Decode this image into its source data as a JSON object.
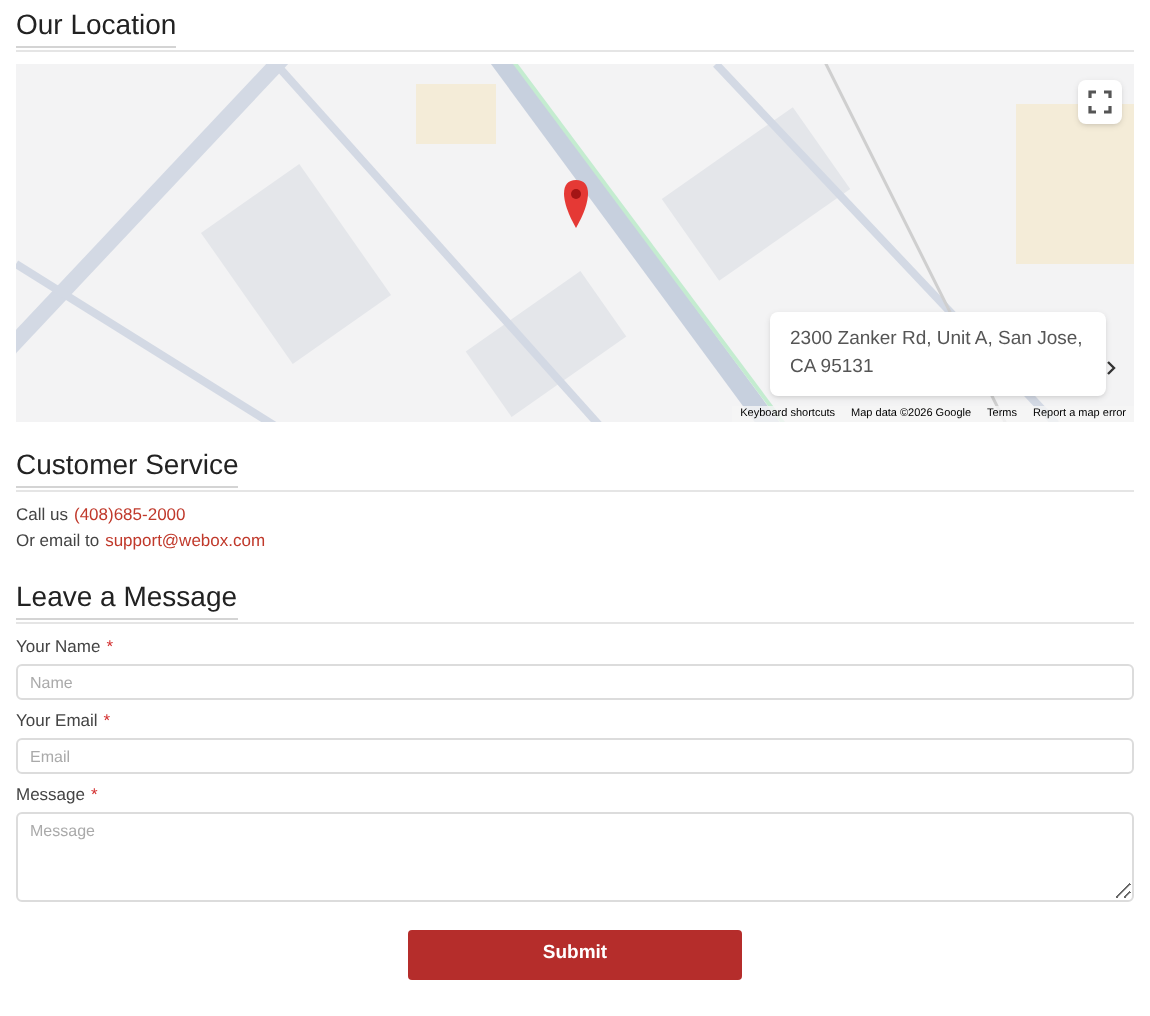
{
  "location": {
    "heading": "Our Location",
    "map": {
      "kind": "picture",
      "address_card": "2300 Zanker Rd, Unit A, San Jose, CA 95131",
      "footer_links": [
        "Keyboard shortcuts",
        "Map data ©2026 Google",
        "Terms",
        "Report a map error"
      ]
    }
  },
  "customer_service": {
    "heading": "Customer Service",
    "lines": [
      {
        "prefix": "Call us",
        "link": "(408)685-2000"
      },
      {
        "prefix": "Or email to",
        "link": "support@webox.com"
      }
    ]
  },
  "message_form": {
    "heading": "Leave a Message",
    "fields": [
      {
        "kind": "input",
        "label": "Your Name",
        "required_mark": "*",
        "placeholder": "Name"
      },
      {
        "kind": "input",
        "label": "Your Email",
        "required_mark": "*",
        "placeholder": "Email"
      },
      {
        "kind": "textarea",
        "label": "Message",
        "required_mark": "*",
        "placeholder": "Message"
      }
    ],
    "submit": "Submit"
  }
}
